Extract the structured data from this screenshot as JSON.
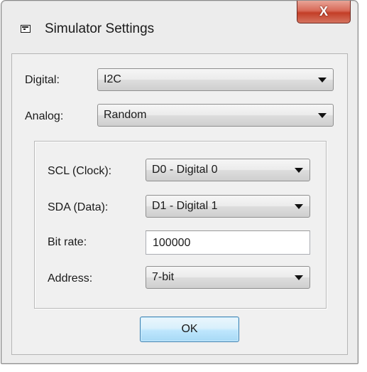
{
  "window": {
    "title": "Simulator Settings",
    "close_label": "X"
  },
  "fields": {
    "digital": {
      "label": "Digital:",
      "value": "I2C"
    },
    "analog": {
      "label": "Analog:",
      "value": "Random"
    }
  },
  "i2c": {
    "scl": {
      "label": "SCL (Clock):",
      "value": "D0 - Digital 0"
    },
    "sda": {
      "label": "SDA (Data):",
      "value": "D1 - Digital 1"
    },
    "bitrate": {
      "label": "Bit rate:",
      "value": "100000"
    },
    "address": {
      "label": "Address:",
      "value": "7-bit"
    }
  },
  "buttons": {
    "ok": "OK"
  },
  "colors": {
    "close_button": "#c33e27",
    "ok_border": "#3c7fb1"
  },
  "icons": {
    "window": "window-icon",
    "close": "close-icon",
    "dropdown": "chevron-down-icon"
  }
}
